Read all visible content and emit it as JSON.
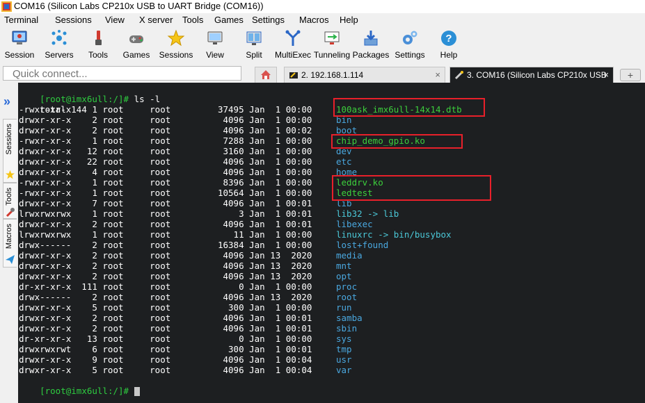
{
  "window": {
    "title": "COM16  (Silicon Labs CP210x USB to UART Bridge (COM16))"
  },
  "menu": [
    "Terminal",
    "Sessions",
    "View",
    "X server",
    "Tools",
    "Games",
    "Settings",
    "Macros",
    "Help"
  ],
  "toolbar": [
    "Session",
    "Servers",
    "Tools",
    "Games",
    "Sessions",
    "View",
    "Split",
    "MultiExec",
    "Tunneling",
    "Packages",
    "Settings",
    "Help"
  ],
  "quick_connect": {
    "placeholder": "Quick connect..."
  },
  "tabs": [
    {
      "label": "2. 192.168.1.114",
      "close": "×"
    },
    {
      "label": "3. COM16  (Silicon Labs CP210x USB",
      "close": "×"
    }
  ],
  "new_tab": "+",
  "side_tabs": [
    "Sessions",
    "Tools",
    "Macros"
  ],
  "terminal": {
    "prompt": "[root@imx6ull:/]#",
    "command": " ls -l",
    "total": "total 144",
    "entries": [
      {
        "meta": "-rwxr-xr-x    1 root     root         37495 Jan  1 00:00",
        "name": "100ask_imx6ull-14x14.dtb",
        "type": "exec"
      },
      {
        "meta": "drwxr-xr-x    2 root     root          4096 Jan  1 00:00",
        "name": "bin",
        "type": "dir"
      },
      {
        "meta": "drwxr-xr-x    2 root     root          4096 Jan  1 00:02",
        "name": "boot",
        "type": "dir"
      },
      {
        "meta": "-rwxr-xr-x    1 root     root          7288 Jan  1 00:00",
        "name": "chip_demo_gpio.ko",
        "type": "exec"
      },
      {
        "meta": "drwxr-xr-x   12 root     root          3160 Jan  1 00:00",
        "name": "dev",
        "type": "dir"
      },
      {
        "meta": "drwxr-xr-x   22 root     root          4096 Jan  1 00:00",
        "name": "etc",
        "type": "dir"
      },
      {
        "meta": "drwxr-xr-x    4 root     root          4096 Jan  1 00:00",
        "name": "home",
        "type": "dir"
      },
      {
        "meta": "-rwxr-xr-x    1 root     root          8396 Jan  1 00:00",
        "name": "leddrv.ko",
        "type": "exec"
      },
      {
        "meta": "-rwxr-xr-x    1 root     root         10564 Jan  1 00:00",
        "name": "ledtest",
        "type": "exec"
      },
      {
        "meta": "drwxr-xr-x    7 root     root          4096 Jan  1 00:01",
        "name": "lib",
        "type": "dir"
      },
      {
        "meta": "lrwxrwxrwx    1 root     root             3 Jan  1 00:01",
        "name": "lib32 -> lib",
        "type": "link"
      },
      {
        "meta": "drwxr-xr-x    2 root     root          4096 Jan  1 00:01",
        "name": "libexec",
        "type": "dir"
      },
      {
        "meta": "lrwxrwxrwx    1 root     root            11 Jan  1 00:00",
        "name": "linuxrc -> bin/busybox",
        "type": "link"
      },
      {
        "meta": "drwx------    2 root     root         16384 Jan  1 00:00",
        "name": "lost+found",
        "type": "dir"
      },
      {
        "meta": "drwxr-xr-x    2 root     root          4096 Jan 13  2020",
        "name": "media",
        "type": "dir"
      },
      {
        "meta": "drwxr-xr-x    2 root     root          4096 Jan 13  2020",
        "name": "mnt",
        "type": "dir"
      },
      {
        "meta": "drwxr-xr-x    2 root     root          4096 Jan 13  2020",
        "name": "opt",
        "type": "dir"
      },
      {
        "meta": "dr-xr-xr-x  111 root     root             0 Jan  1 00:00",
        "name": "proc",
        "type": "dir"
      },
      {
        "meta": "drwx------    2 root     root          4096 Jan 13  2020",
        "name": "root",
        "type": "dir"
      },
      {
        "meta": "drwxr-xr-x    5 root     root           300 Jan  1 00:00",
        "name": "run",
        "type": "dir"
      },
      {
        "meta": "drwxr-xr-x    2 root     root          4096 Jan  1 00:01",
        "name": "samba",
        "type": "dir"
      },
      {
        "meta": "drwxr-xr-x    2 root     root          4096 Jan  1 00:01",
        "name": "sbin",
        "type": "dir"
      },
      {
        "meta": "dr-xr-xr-x   13 root     root             0 Jan  1 00:00",
        "name": "sys",
        "type": "dir"
      },
      {
        "meta": "drwxrwxrwt    6 root     root           300 Jan  1 00:01",
        "name": "tmp",
        "type": "dir"
      },
      {
        "meta": "drwxr-xr-x    9 root     root          4096 Jan  1 00:04",
        "name": "usr",
        "type": "dir"
      },
      {
        "meta": "drwxr-xr-x    5 root     root          4096 Jan  1 00:04",
        "name": "var",
        "type": "dir"
      }
    ]
  },
  "colors": {
    "terminal_bg": "#1d1f21",
    "prompt": "#2ecc40",
    "exec_file": "#3ccf3c",
    "directory": "#4aa8e0",
    "symlink": "#4bc8d8",
    "highlight_box": "#e8202a"
  }
}
